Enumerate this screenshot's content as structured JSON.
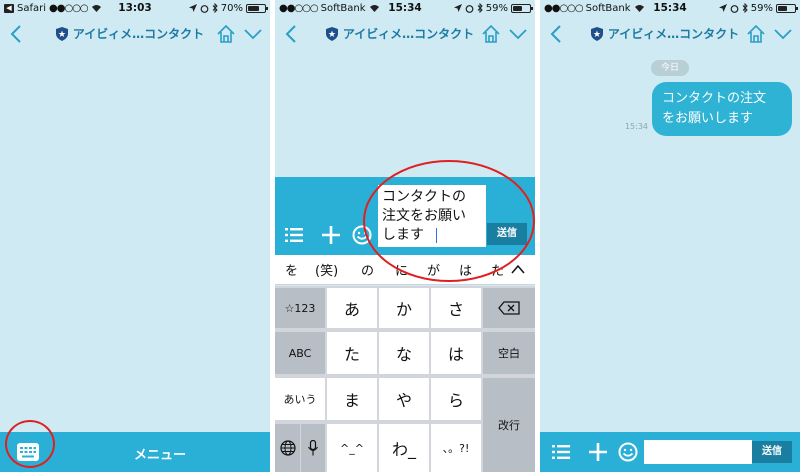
{
  "screens": [
    {
      "status": {
        "carrier": "Safari",
        "time": "13:03",
        "battery": "70%",
        "battery_level": 0.7
      },
      "header": {
        "title": "アイビィメ…コンタクト"
      },
      "menu": {
        "label": "メニュー"
      }
    },
    {
      "status": {
        "carrier": "SoftBank",
        "time": "15:34",
        "battery": "59%",
        "battery_level": 0.59
      },
      "header": {
        "title": "アイビィメ…コンタクト"
      },
      "composer": {
        "input_lines": [
          "コンタクトの",
          "注文をお願い",
          "します"
        ],
        "send_label": "送信"
      },
      "suggestions": [
        "を",
        "(笑)",
        "の",
        "に",
        "が",
        "は",
        "た"
      ],
      "keyboard": {
        "left": [
          "☆123",
          "ABC",
          "あいう"
        ],
        "rows": [
          [
            "あ",
            "か",
            "さ"
          ],
          [
            "た",
            "な",
            "は"
          ],
          [
            "ま",
            "や",
            "ら"
          ],
          [
            "^_^",
            "わ_",
            "、。?!"
          ]
        ],
        "space": "空白",
        "newline": "改行"
      }
    },
    {
      "status": {
        "carrier": "SoftBank",
        "time": "15:34",
        "battery": "59%",
        "battery_level": 0.59
      },
      "header": {
        "title": "アイビィメ…コンタクト"
      },
      "chat": {
        "date": "今日",
        "message_lines": [
          "コンタクトの注文",
          "をお願いします"
        ],
        "time": "15:34"
      },
      "composer": {
        "send_label": "送信"
      }
    }
  ],
  "colors": {
    "background": "#cfeaf2",
    "accent": "#2ab0d6",
    "send": "#197ea0",
    "highlight": "#e02020"
  },
  "icons": [
    "back-chevron-icon",
    "shield-icon",
    "home-icon",
    "chevron-down-icon",
    "keyboard-icon",
    "list-icon",
    "plus-icon",
    "smile-icon",
    "delete-icon",
    "globe-icon",
    "mic-icon",
    "wifi-icon",
    "location-icon",
    "alarm-icon",
    "bluetooth-icon",
    "battery-icon"
  ]
}
